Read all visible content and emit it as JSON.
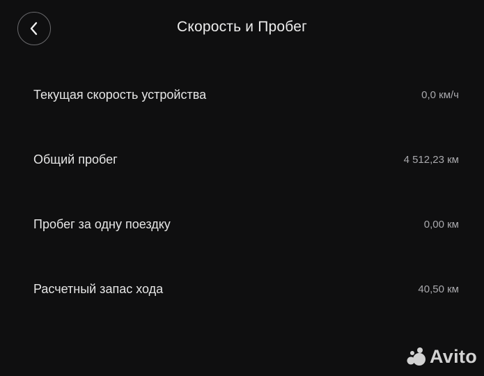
{
  "header": {
    "title": "Скорость и Пробег",
    "back_icon": "chevron-left-icon"
  },
  "rows": [
    {
      "label": "Текущая скорость устройства",
      "value": "0,0 км/ч"
    },
    {
      "label": "Общий пробег",
      "value": "4 512,23 км"
    },
    {
      "label": "Пробег за одну поездку",
      "value": "0,00 км"
    },
    {
      "label": "Расчетный запас хода",
      "value": "40,50 км"
    }
  ],
  "watermark": {
    "text": "Avito"
  },
  "colors": {
    "background": "#0f0f10",
    "text_primary": "#e6e6e6",
    "text_secondary": "#a9a9ad",
    "button_border": "#6a6a6d"
  }
}
